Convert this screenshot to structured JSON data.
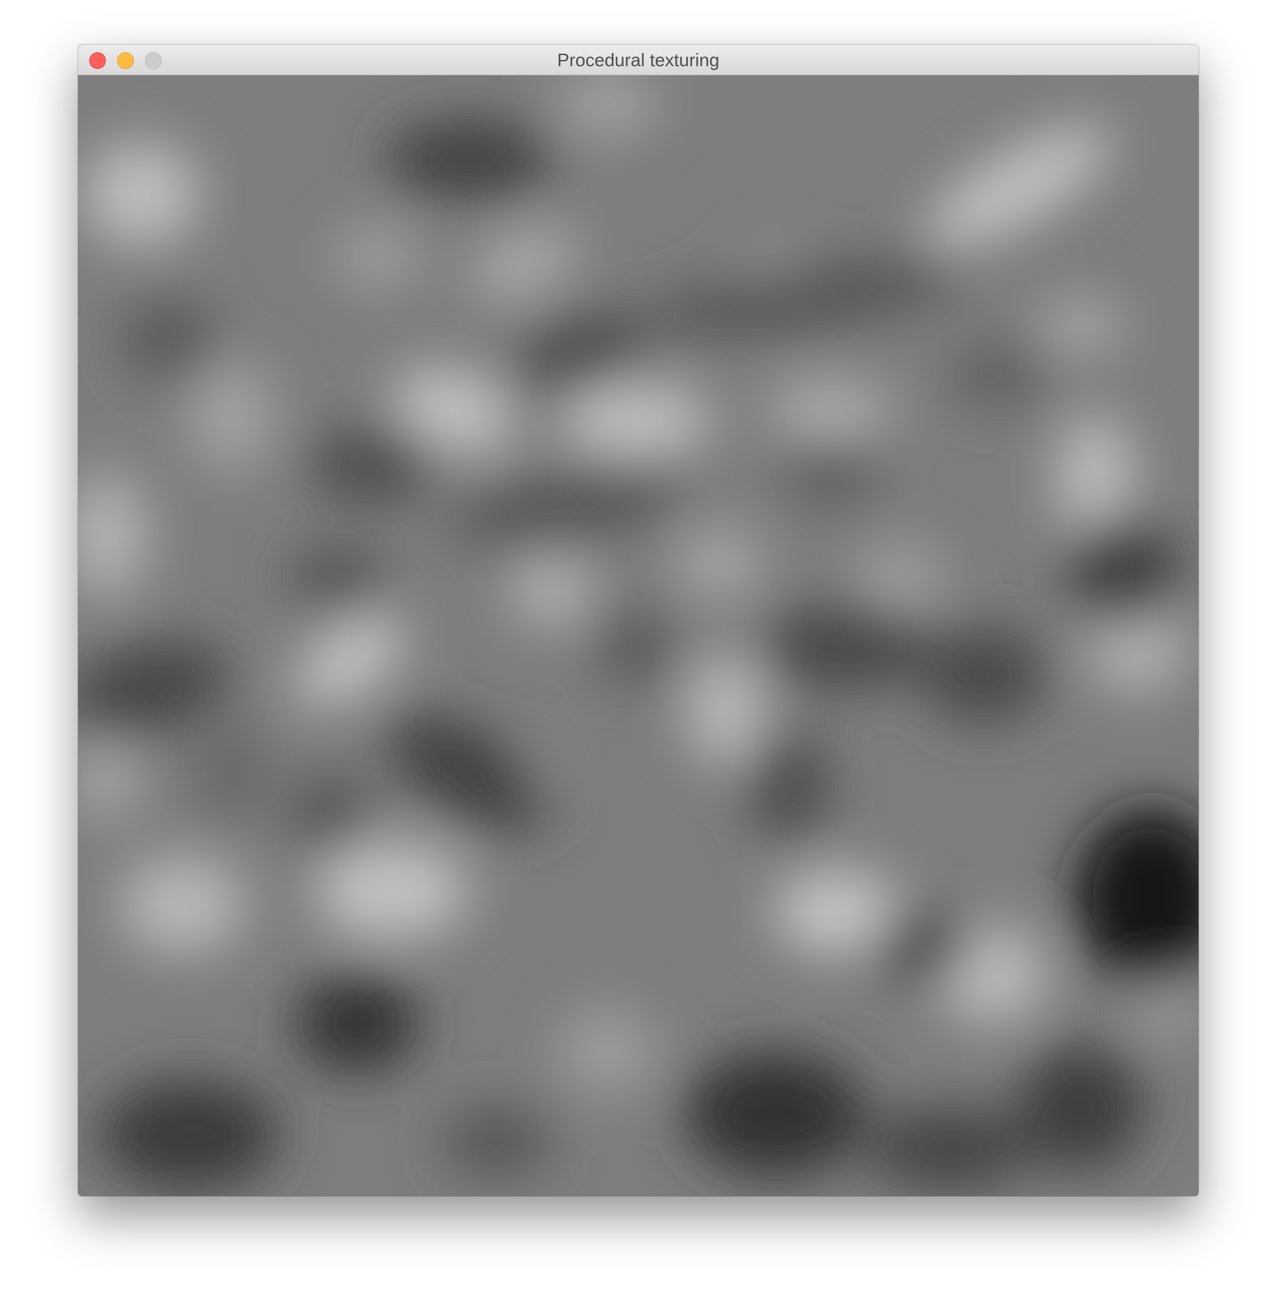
{
  "window": {
    "title": "Procedural texturing"
  },
  "traffic_lights": {
    "close_color": "#fc605c",
    "minimize_color": "#fdbc40",
    "zoom_color": "#cdcdcd"
  },
  "canvas": {
    "content": "grayscale procedural noise texture",
    "base_color": "#7d7d7d"
  }
}
